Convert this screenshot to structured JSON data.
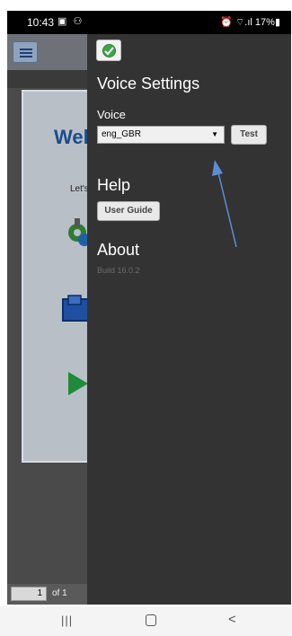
{
  "status_bar": {
    "time": "10:43",
    "left_icons": "▣ ⚇",
    "right_text": "⏰ ⌔.ıl 17%▮"
  },
  "background_app": {
    "welcome_text": "Wel",
    "subtitle": "Let's",
    "pagination": {
      "current_page": "1",
      "of_label": "of 1"
    }
  },
  "drawer": {
    "voice_settings": {
      "title": "Voice Settings",
      "voice_label": "Voice",
      "selected_voice": "eng_GBR",
      "test_button": "Test"
    },
    "help": {
      "title": "Help",
      "user_guide_button": "User Guide"
    },
    "about": {
      "title": "About",
      "build": "Build 16.0.2"
    }
  },
  "colors": {
    "drawer_bg": "#333333",
    "accent_green": "#3ea54a",
    "annotation_arrow": "#5a8fd6",
    "title_blue": "#1c4d8c"
  },
  "nav_bar": {
    "recents": "|||",
    "back": "<"
  }
}
